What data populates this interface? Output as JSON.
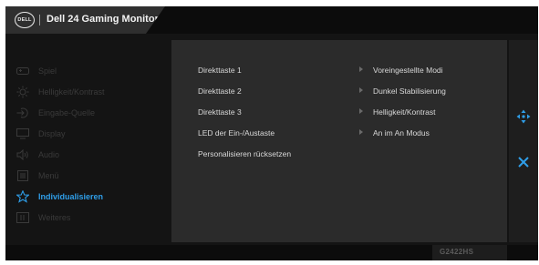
{
  "header": {
    "logo_text": "DELL",
    "title": "Dell 24 Gaming Monitor"
  },
  "nav": {
    "items": [
      {
        "label": "Spiel",
        "icon": "gamepad-icon",
        "active": false
      },
      {
        "label": "Helligkeit/Kontrast",
        "icon": "brightness-icon",
        "active": false
      },
      {
        "label": "Eingabe-Quelle",
        "icon": "input-source-icon",
        "active": false
      },
      {
        "label": "Display",
        "icon": "display-icon",
        "active": false
      },
      {
        "label": "Audio",
        "icon": "speaker-icon",
        "active": false
      },
      {
        "label": "Menü",
        "icon": "menu-icon",
        "active": false
      },
      {
        "label": "Individualisieren",
        "icon": "star-icon",
        "active": true
      },
      {
        "label": "Weiteres",
        "icon": "info-icon",
        "active": false
      }
    ]
  },
  "content": {
    "rows": [
      {
        "label": "Direkttaste 1",
        "value": "Voreingestellte Modi"
      },
      {
        "label": "Direkttaste 2",
        "value": "Dunkel Stabilisierung"
      },
      {
        "label": "Direkttaste 3",
        "value": "Helligkeit/Kontrast"
      },
      {
        "label": "LED der Ein-/Austaste",
        "value": "An im An Modus"
      },
      {
        "label": "Personalisieren rücksetzen",
        "value": ""
      }
    ]
  },
  "rightbar": {
    "move_icon": "move-arrows-icon",
    "close_icon": "close-icon"
  },
  "footer": {
    "model": "G2422HS"
  },
  "colors": {
    "accent": "#2f9ee8",
    "panel": "#2b2b2b",
    "background": "#141414"
  }
}
